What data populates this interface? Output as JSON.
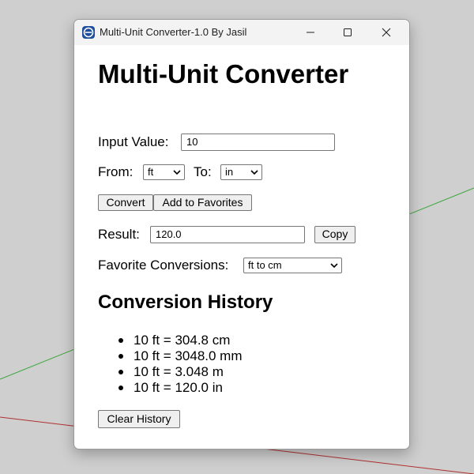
{
  "window": {
    "title": "Multi-Unit Converter-1.0 By Jasil"
  },
  "app": {
    "heading": "Multi-Unit Converter",
    "input_label": "Input Value:",
    "input_value": "10",
    "from_label": "From:",
    "from_selected": "ft",
    "to_label": "To:",
    "to_selected": "in",
    "convert_label": "Convert",
    "add_favorites_label": "Add to Favorites",
    "result_label": "Result:",
    "result_value": "120.0",
    "copy_label": "Copy",
    "favorites_label": "Favorite Conversions:",
    "favorites_selected": "ft to cm",
    "history_heading": "Conversion History",
    "history": [
      "10 ft = 304.8 cm",
      "10 ft = 3048.0 mm",
      "10 ft = 3.048 m",
      "10 ft = 120.0 in"
    ],
    "clear_history_label": "Clear History"
  },
  "colors": {
    "desktop": "#cfcfcf",
    "titlebar": "#f3f3f3",
    "window_bg": "#ffffff",
    "button_bg": "#efefef",
    "app_icon": "#1f4e9c",
    "axis_green": "#3aa53a",
    "axis_red": "#b03030"
  },
  "icons": {
    "app": "app-logo-icon",
    "minimize": "minimize-icon",
    "maximize": "maximize-icon",
    "close": "close-icon",
    "dropdown": "chevron-down-icon"
  }
}
